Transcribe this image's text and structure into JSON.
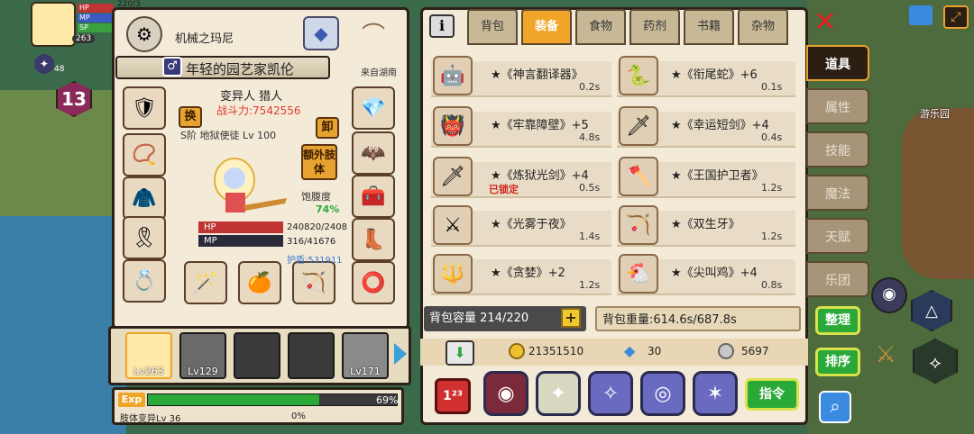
{
  "hud": {
    "hp_label": "HP",
    "mp_label": "MP",
    "sp_label": "SP",
    "level": "263",
    "top_number": "220/3",
    "badge_number": "48",
    "level_badge": "13",
    "map_label": "游乐园"
  },
  "character": {
    "title": "机械之玛尼",
    "name": "年轻的园艺家凯伦",
    "origin": "来自湖南",
    "class": "变异人 猎人",
    "power_label": "战斗力:7542556",
    "swap_label": "换",
    "unequip_label": "卸",
    "pet_text": "S阶 地狱使徒 Lv 100",
    "extra_limb_label": "额外肢体",
    "satiety_label": "饱腹度",
    "satiety_value": "74%",
    "hp_text": "HP",
    "hp_value": "240820/2408",
    "mp_text": "MP",
    "mp_value": "316/41676",
    "shield_value": "护盾:531911"
  },
  "party": [
    {
      "lv": "Lv263"
    },
    {
      "lv": "Lv129"
    },
    {
      "lv": ""
    },
    {
      "lv": ""
    },
    {
      "lv": "Lv171"
    }
  ],
  "exp": {
    "label": "Exp",
    "percent": 69,
    "percent_text": "69%",
    "limb_label": "肢体变异Lv 36",
    "limb_percent_text": "0%"
  },
  "inventory": {
    "info_icon": "i",
    "tabs": [
      {
        "label": "背包",
        "active": false
      },
      {
        "label": "装备",
        "active": true
      },
      {
        "label": "食物",
        "active": false
      },
      {
        "label": "药剂",
        "active": false
      },
      {
        "label": "书籍",
        "active": false
      },
      {
        "label": "杂物",
        "active": false
      }
    ],
    "items_left": [
      {
        "name": "★《神言翻译器》",
        "weight": "0.2s",
        "locked": ""
      },
      {
        "name": "★《牢靠障壁》+5",
        "weight": "4.8s",
        "locked": ""
      },
      {
        "name": "★《炼狱光剑》+4",
        "weight": "0.5s",
        "locked": "已锁定"
      },
      {
        "name": "★《光雾于夜》",
        "weight": "1.4s",
        "locked": ""
      },
      {
        "name": "★《贪婪》+2",
        "weight": "1.2s",
        "locked": ""
      }
    ],
    "items_right": [
      {
        "name": "★《衔尾蛇》+6",
        "weight": "0.1s"
      },
      {
        "name": "★《幸运短剑》+4",
        "weight": "0.4s"
      },
      {
        "name": "★《王国护卫者》",
        "weight": "1.2s"
      },
      {
        "name": "★《双生牙》",
        "weight": "1.2s"
      },
      {
        "name": "★《尖叫鸡》+4",
        "weight": "0.8s"
      }
    ],
    "capacity": "背包容量 214/220",
    "weight": "背包重量:614.6s/687.8s",
    "gold": "21351510",
    "diamonds": "30",
    "silver": "5697",
    "command_label": "指令"
  },
  "side_menu": [
    {
      "label": "道具",
      "active": true
    },
    {
      "label": "属性",
      "active": false
    },
    {
      "label": "技能",
      "active": false
    },
    {
      "label": "魔法",
      "active": false
    },
    {
      "label": "天赋",
      "active": false
    },
    {
      "label": "乐团",
      "active": false
    }
  ],
  "buttons": {
    "organize": "整理",
    "sort": "排序"
  },
  "colors": {
    "accent": "#f0a428",
    "panel": "#f3ead8",
    "border": "#2b2118",
    "exp_bar": "#2aa838",
    "lock_red": "#d0281e"
  }
}
